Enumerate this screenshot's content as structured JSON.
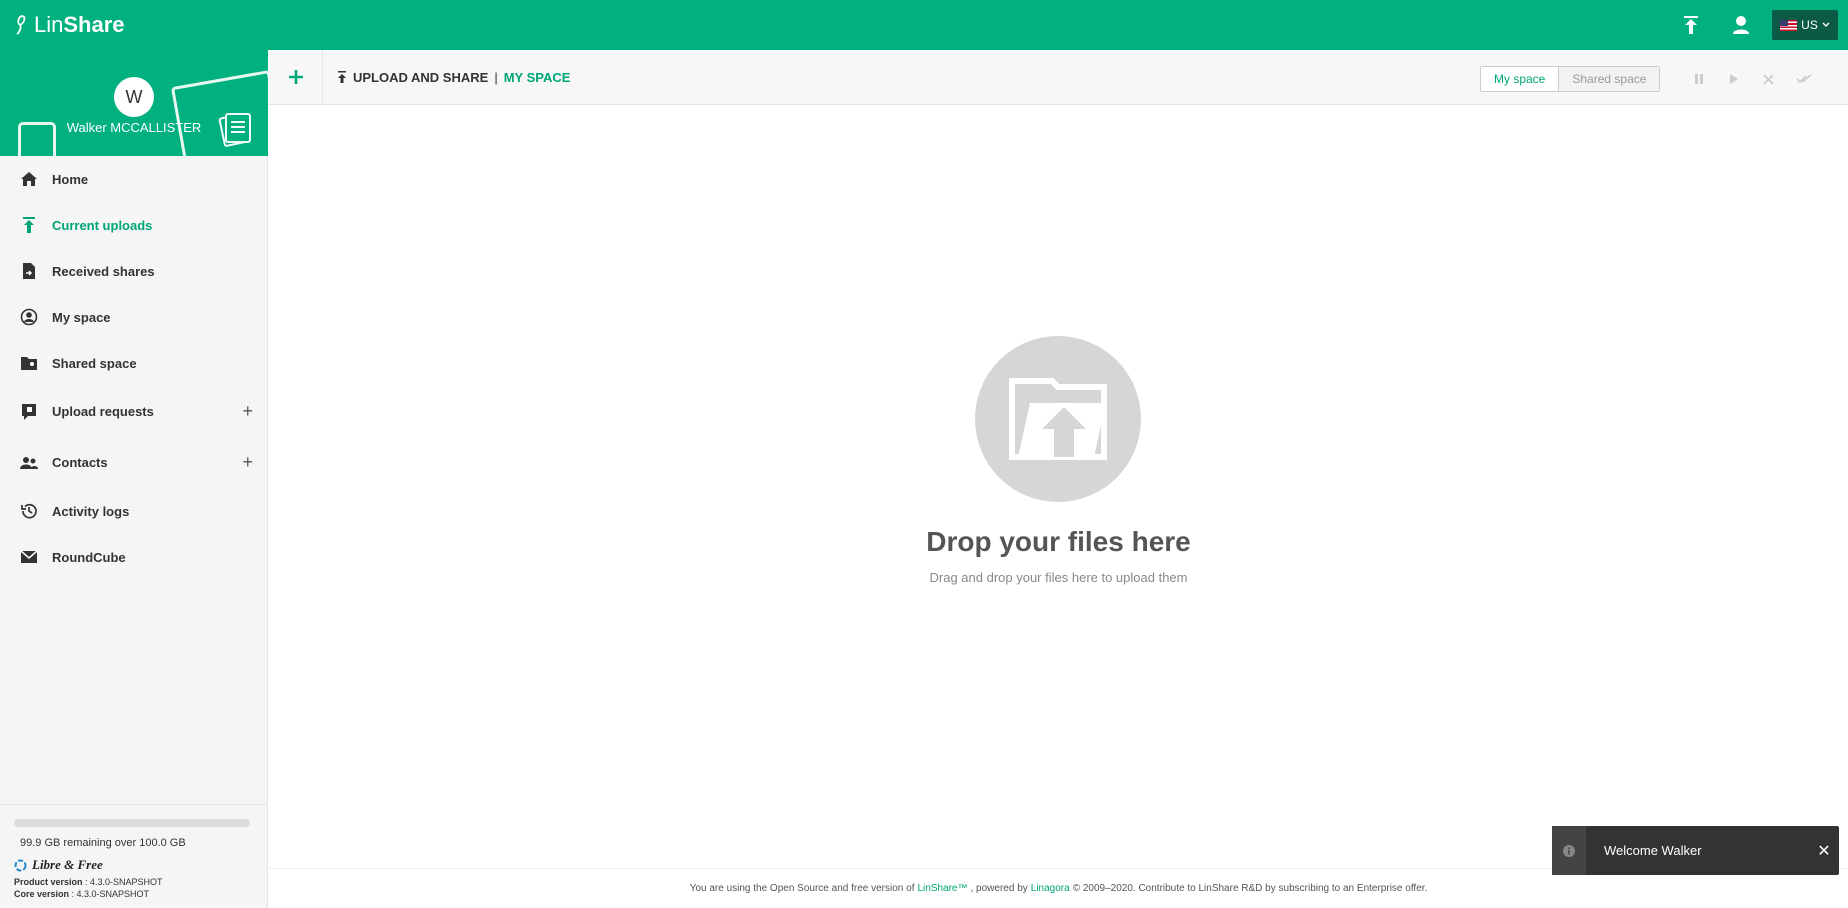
{
  "app": {
    "logo_lin": "Lin",
    "logo_share": "Share",
    "lang": "US"
  },
  "user": {
    "initial": "W",
    "name": "Walker MCCALLISTER"
  },
  "nav": [
    {
      "label": "Home",
      "icon": "home-icon"
    },
    {
      "label": "Current uploads",
      "icon": "upload-icon",
      "active": true
    },
    {
      "label": "Received shares",
      "icon": "received-shares-icon"
    },
    {
      "label": "My space",
      "icon": "user-circle-icon"
    },
    {
      "label": "Shared space",
      "icon": "shared-folder-icon"
    },
    {
      "label": "Upload requests",
      "icon": "upload-request-icon",
      "plus": "+"
    },
    {
      "label": "Contacts",
      "icon": "contacts-icon",
      "plus": "+"
    },
    {
      "label": "Activity logs",
      "icon": "history-icon"
    },
    {
      "label": "RoundCube",
      "icon": "mail-icon"
    }
  ],
  "quota": {
    "used_fraction": 0.001,
    "text": "99.9 GB remaining over 100.0 GB"
  },
  "brand": {
    "libre": "Libre & Free",
    "product_label": "Product version",
    "product_value": " : 4.3.0-SNAPSHOT",
    "core_label": "Core version",
    "core_value": " : 4.3.0-SNAPSHOT"
  },
  "header": {
    "crumb_root": "UPLOAD AND SHARE",
    "crumb_sep": "|",
    "crumb_current": "MY SPACE",
    "tab_my_space": "My space",
    "tab_shared_space": "Shared space"
  },
  "dropzone": {
    "title": "Drop your files here",
    "subtitle": "Drag and drop your files here to upload them"
  },
  "footer": {
    "part1": "You are using the Open Source and free version of",
    "link1": "LinShare™",
    "part2": ", powered by",
    "link2": "Linagora",
    "part3": "© 2009–2020. Contribute to LinShare R&D by subscribing to an Enterprise offer."
  },
  "toast": {
    "message": "Welcome Walker",
    "close": "✕"
  },
  "colors": {
    "brand": "#00b07e",
    "accent": "#00a57a"
  }
}
